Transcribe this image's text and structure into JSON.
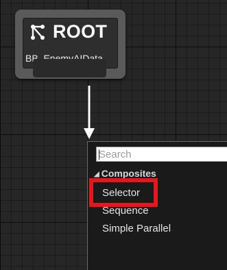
{
  "root_node": {
    "title": "ROOT",
    "blackboard": "BB_EnemyAIData",
    "icon": "root-branch-icon"
  },
  "connector": {
    "icon": "arrow-down-icon"
  },
  "context_menu": {
    "search": {
      "placeholder": "Search",
      "value": ""
    },
    "category": {
      "label": "Composites",
      "expanded": true
    },
    "items": [
      {
        "label": "Selector",
        "highlighted": true
      },
      {
        "label": "Sequence",
        "highlighted": false
      },
      {
        "label": "Simple Parallel",
        "highlighted": false
      }
    ]
  },
  "colors": {
    "highlight_box": "#e2171f",
    "graph_background": "#262626",
    "node_body": "#5a5a5a",
    "menu_background": "#1a1a1a"
  }
}
